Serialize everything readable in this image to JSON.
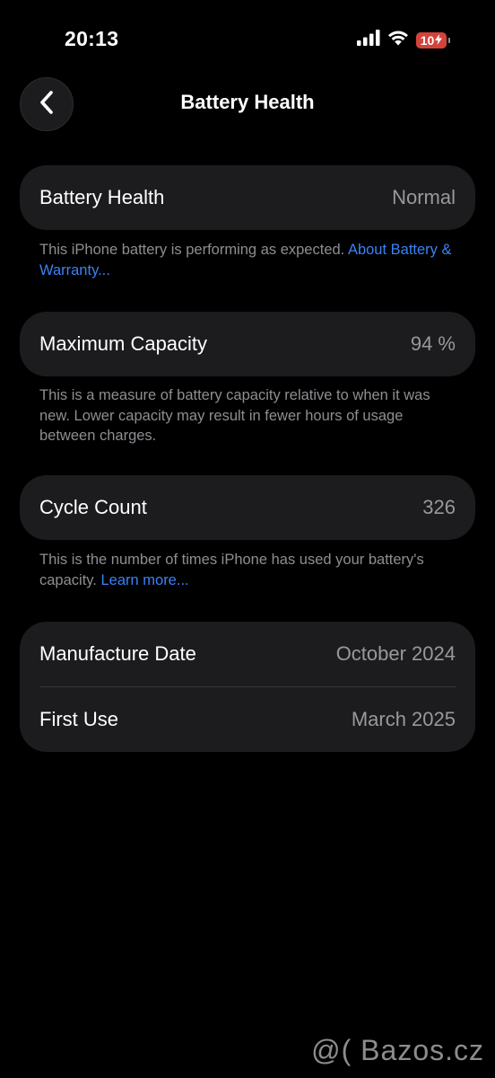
{
  "status_bar": {
    "time": "20:13",
    "battery_level": "10",
    "battery_fraction": 0.1,
    "battery_color": "#e5453a",
    "icons": [
      "cellular-signal-icon",
      "wifi-icon",
      "battery-icon",
      "charging-bolt-icon"
    ]
  },
  "nav": {
    "back_icon": "chevron-left-icon",
    "title": "Battery Health"
  },
  "battery_health": {
    "label": "Battery Health",
    "value": "Normal",
    "footnote_text": "This iPhone battery is performing as expected.",
    "footnote_link": "About Battery & Warranty..."
  },
  "maximum_capacity": {
    "label": "Maximum Capacity",
    "value": "94 %",
    "footnote_text": "This is a measure of battery capacity relative to when it was new. Lower capacity may result in fewer hours of usage between charges."
  },
  "cycle_count": {
    "label": "Cycle Count",
    "value": "326",
    "footnote_text": "This is the number of times iPhone has used your battery's capacity.",
    "footnote_link": "Learn more..."
  },
  "dates": {
    "manufacture_label": "Manufacture Date",
    "manufacture_value": "October 2024",
    "first_use_label": "First Use",
    "first_use_value": "March 2025"
  },
  "watermark": "@( Bazos.cz",
  "colors": {
    "background": "#000000",
    "card": "#1c1c1e",
    "link": "#3b82f6",
    "secondary_text": "#8e8e93"
  }
}
